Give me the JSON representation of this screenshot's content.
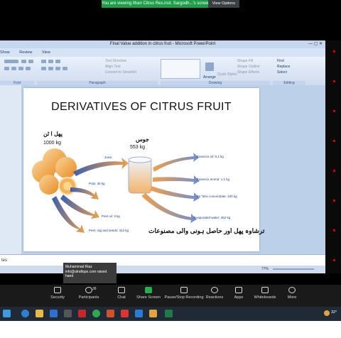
{
  "banner": {
    "message": "You are viewing Ilhan Citrus Res.inst. Sargodh...'s screen",
    "view_options": "View Options"
  },
  "ppt": {
    "window_title": "Final Value addition in citrus fruit - Microsoft PowerPoint",
    "tabs": [
      "Show",
      "Review",
      "View"
    ],
    "ribbon": {
      "text_direction": "Text Direction",
      "align_text": "Align Text",
      "convert_smartart": "Convert to SmartArt",
      "arrange": "Arrange",
      "quick_styles": "Quick Styles",
      "shape_fill": "Shape Fill",
      "shape_outline": "Shape Outline",
      "shape_effects": "Shape Effects",
      "find": "Find",
      "replace": "Replace",
      "select": "Select",
      "groups": {
        "font": "Font",
        "paragraph": "Paragraph",
        "drawing": "Drawing",
        "editing": "Editing"
      }
    },
    "notes_text": "tes",
    "zoom": "77%"
  },
  "slide": {
    "title": "DERIVATIVES OF CITRUS FRUIT",
    "fruit_label_urdu": "پھل ا ٹن",
    "fruit_weight": "1000 kg",
    "juice_label_urdu": "جوس",
    "juice_weight": "553 kg",
    "labels": {
      "juice": "Juice",
      "pulp": "Pulp: 30 kg",
      "peel_oil": "Peel oil: 3 kg",
      "peel_rag_seeds": "Peel, rag and seeds: 413 kg",
      "essence_oil": "Essence oil: 0.1 kg",
      "essence_aroma": "Essence aroma: 1.1 kg",
      "brix": "65 °Brix concentrate: 100 kg",
      "evaporated": "Evaporated water: 452 kg"
    },
    "urdu_caption": "ترشاوہ پھل اور حاصل ہونی والی مصنوعات"
  },
  "tooltip": {
    "name": "Muhammad Riaz",
    "email": "info@alrafique.com raised",
    "suffix": "hand"
  },
  "zoom_toolbar": {
    "security": "Security",
    "participants": "Participants",
    "participants_count": "38",
    "chat": "Chat",
    "share_screen": "Share Screen",
    "record": "Pause/Stop Recording",
    "reactions": "Reactions",
    "apps": "Apps",
    "whiteboards": "Whiteboards",
    "more": "More"
  },
  "taskbar": {
    "temperature": "32°"
  },
  "colors": {
    "banner_green": "#1e9e4a",
    "arrow_orange": "#f0a04b",
    "arrow_blue": "#3a5fb0",
    "share_green": "#22b14c"
  }
}
